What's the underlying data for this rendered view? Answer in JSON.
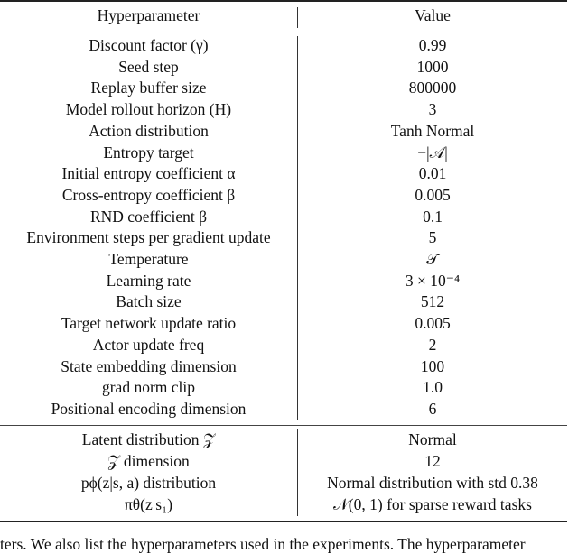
{
  "table": {
    "headers": {
      "param": "Hyperparameter",
      "value": "Value"
    },
    "section1": [
      {
        "param": "Discount factor (γ)",
        "value": "0.99"
      },
      {
        "param": "Seed step",
        "value": "1000"
      },
      {
        "param": "Replay buffer size",
        "value": "800000"
      },
      {
        "param": "Model rollout horizon (H)",
        "value": "3"
      },
      {
        "param": "Action distribution",
        "value": "Tanh Normal"
      },
      {
        "param": "Entropy target",
        "value": "−|𝒜|"
      },
      {
        "param": "Initial entropy coefficient α",
        "value": "0.01"
      },
      {
        "param": "Cross-entropy coefficient β",
        "value": "0.005"
      },
      {
        "param": "RND coefficient β",
        "value": "0.1"
      },
      {
        "param": "Environment steps per gradient update",
        "value": "5"
      },
      {
        "param": "Temperature",
        "value": "𝒯"
      },
      {
        "param": "Learning rate",
        "value": "3 × 10⁻⁴"
      },
      {
        "param": "Batch size",
        "value": "512"
      },
      {
        "param": "Target network update ratio",
        "value": "0.005"
      },
      {
        "param": "Actor update freq",
        "value": "2"
      },
      {
        "param": "State embedding dimension",
        "value": "100"
      },
      {
        "param": "grad norm clip",
        "value": "1.0"
      },
      {
        "param": "Positional encoding dimension",
        "value": "6"
      }
    ],
    "section2": [
      {
        "param": "Latent distribution 𝒵",
        "value": "Normal"
      },
      {
        "param": "𝒵 dimension",
        "value": "12"
      },
      {
        "param": "pϕ(z|s, a) distribution",
        "value": "Normal distribution with std 0.38"
      },
      {
        "param": "πθ(z|s₁)",
        "value": "𝒩(0, 1) for sparse reward tasks"
      }
    ]
  },
  "caption": "ters. We also list the hyperparameters used in the experiments. The hyperparameter"
}
